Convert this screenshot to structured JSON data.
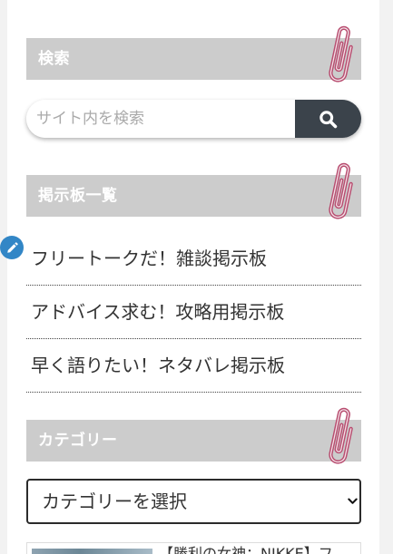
{
  "theme": {
    "page_background": "#f2f2f2",
    "panel_background": "#ffffff",
    "widget_title_background": "#cccccc",
    "widget_title_text": "#ffffff",
    "search_button_background": "#3b434b",
    "edit_button_background": "#3286c6",
    "paperclip_color": "#b84d70",
    "text_color": "#333333"
  },
  "search_widget": {
    "title": "検索",
    "title_icon": "paperclip-icon",
    "input": {
      "value": "",
      "placeholder": "サイト内を検索"
    },
    "submit_icon": "search-icon"
  },
  "edit_button": {
    "icon": "pencil-icon"
  },
  "board_widget": {
    "title": "掲示板一覧",
    "title_icon": "paperclip-icon",
    "items": [
      {
        "label": "フリートークだ！雑談掲示板"
      },
      {
        "label": "アドバイス求む！攻略用掲示板"
      },
      {
        "label": "早く語りたい！ネタバレ掲示板"
      }
    ]
  },
  "category_widget": {
    "title": "カテゴリー",
    "title_icon": "paperclip-icon",
    "select": {
      "selected": "カテゴリーを選択",
      "icon": "chevron-down-icon"
    }
  },
  "post_card": {
    "title": "【勝利の女神：NIKKE】フ"
  }
}
